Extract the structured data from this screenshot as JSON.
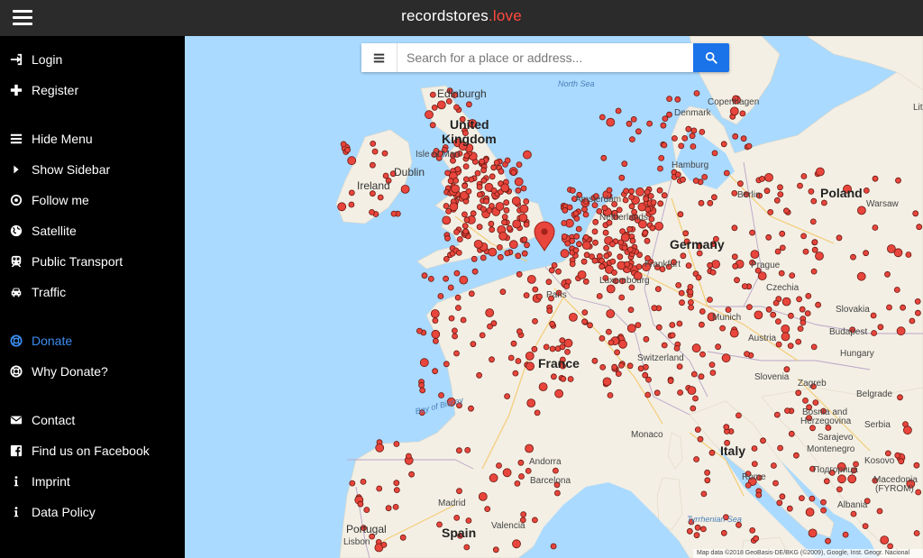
{
  "header": {
    "brand_name": "recordstores",
    "brand_tld": ".love"
  },
  "sidebar": {
    "items": [
      {
        "label": "Login",
        "icon": "sign-in-icon"
      },
      {
        "label": "Register",
        "icon": "plus-icon"
      },
      {
        "label": "Hide Menu",
        "icon": "bars-icon"
      },
      {
        "label": "Show Sidebar",
        "icon": "caret-right-icon"
      },
      {
        "label": "Follow me",
        "icon": "crosshair-icon"
      },
      {
        "label": "Satellite",
        "icon": "globe-icon"
      },
      {
        "label": "Public Transport",
        "icon": "train-icon"
      },
      {
        "label": "Traffic",
        "icon": "car-icon"
      },
      {
        "label": "Donate",
        "icon": "lifebuoy-icon"
      },
      {
        "label": "Why Donate?",
        "icon": "lifebuoy-icon"
      },
      {
        "label": "Contact",
        "icon": "envelope-icon"
      },
      {
        "label": "Find us on Facebook",
        "icon": "facebook-icon"
      },
      {
        "label": "Imprint",
        "icon": "info-icon"
      },
      {
        "label": "Data Policy",
        "icon": "info-icon"
      }
    ],
    "accent_color": "#3b8df0"
  },
  "search": {
    "placeholder": "Search for a place or address..."
  },
  "map": {
    "labels": {
      "north_sea": "North Sea",
      "edinburgh": "Edinburgh",
      "uk_line1": "United",
      "uk_line2": "Kingdom",
      "isle_of_man": "Isle of Man",
      "dublin": "Dublin",
      "ireland": "Ireland",
      "denmark": "Denmark",
      "copenhagen": "Copenhagen",
      "hamburg": "Hamburg",
      "berlin": "Berlin",
      "poland": "Poland",
      "warsaw": "Warsaw",
      "amsterdam": "Amsterdam",
      "netherlands": "Netherlands",
      "germany": "Germany",
      "frankfurt": "Frankfurt",
      "luxembourg": "Luxembourg",
      "prague": "Prague",
      "czechia": "Czechia",
      "slovakia": "Slovakia",
      "paris": "Paris",
      "munich": "Munich",
      "austria": "Austria",
      "budapest": "Budapest",
      "hungary": "Hungary",
      "france": "France",
      "switzerland": "Switzerland",
      "slovenia": "Slovenia",
      "zagreb": "Zagreb",
      "bay_of_biscay": "Bay of Biscay",
      "bosnia_line1": "Bosnia and",
      "bosnia_line2": "Herzegovina",
      "belgrade": "Belgrade",
      "serbia": "Serbia",
      "montenegro": "Montenegro",
      "sarajevo": "Sarajevo",
      "monaco": "Monaco",
      "italy": "Italy",
      "podgorica": "Подгорица",
      "kosovo": "Kosovo",
      "andorra": "Andorra",
      "barcelona": "Barcelona",
      "rome": "Rome",
      "macedonia_line1": "Macedonia",
      "macedonia_line2": "(FYROM)",
      "albania": "Albania",
      "madrid": "Madrid",
      "portugal": "Portugal",
      "valencia": "Valencia",
      "spain": "Spain",
      "lisbon": "Lisbon",
      "tyrrhenian_sea": "Tyrrhenian Sea",
      "lithuania": "Lit"
    },
    "attribution": "Map data ©2018 GeoBasis-DE/BKG (©2009), Google, Inst. Geogr. Nacional",
    "colors": {
      "water": "#aadaff",
      "land": "#f5f1e6",
      "marker_fill": "#e8453c",
      "marker_stroke": "#6a1a12",
      "pin": "#e8453c"
    }
  }
}
